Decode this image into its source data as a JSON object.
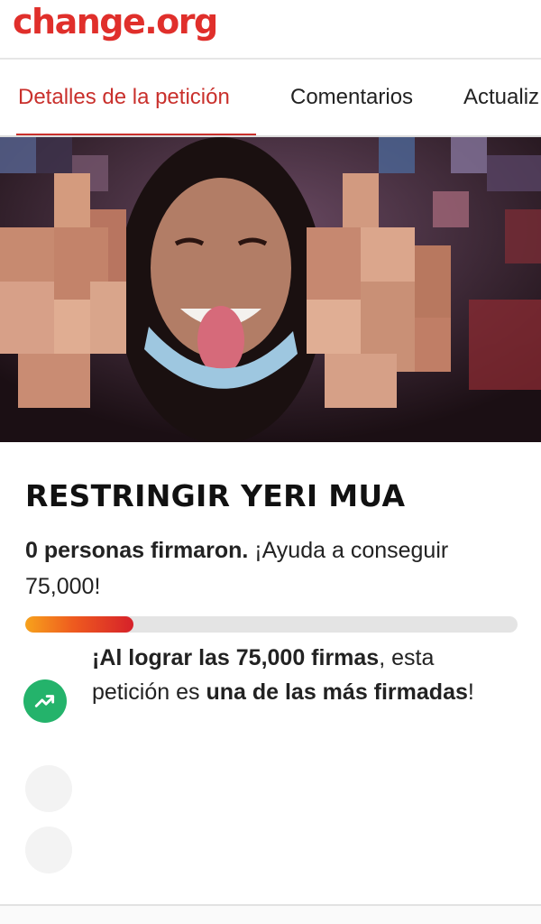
{
  "header": {
    "logo": "change.org"
  },
  "tabs": [
    {
      "label": "Detalles de la petición",
      "active": true
    },
    {
      "label": "Comentarios",
      "active": false
    },
    {
      "label": "Actualiz",
      "active": false
    }
  ],
  "hero": {
    "icon": "petition-photo"
  },
  "petition": {
    "title": "RESTRINGIR YERI MUA",
    "signed_bold": "0 personas firmaron.",
    "signed_rest": " ¡Ayuda a conseguir 75,000!",
    "progress_fraction": 0.22
  },
  "milestone": {
    "part1": "¡",
    "part2": "Al lograr las 75,000 firmas",
    "part3": ", esta petición es ",
    "part4": "una de las más firmadas",
    "part5": "!",
    "icon": "trending-up-icon",
    "icon_color": "#24b36b"
  },
  "colors": {
    "brand": "#e02f2b",
    "tab_active": "#c9302c"
  }
}
